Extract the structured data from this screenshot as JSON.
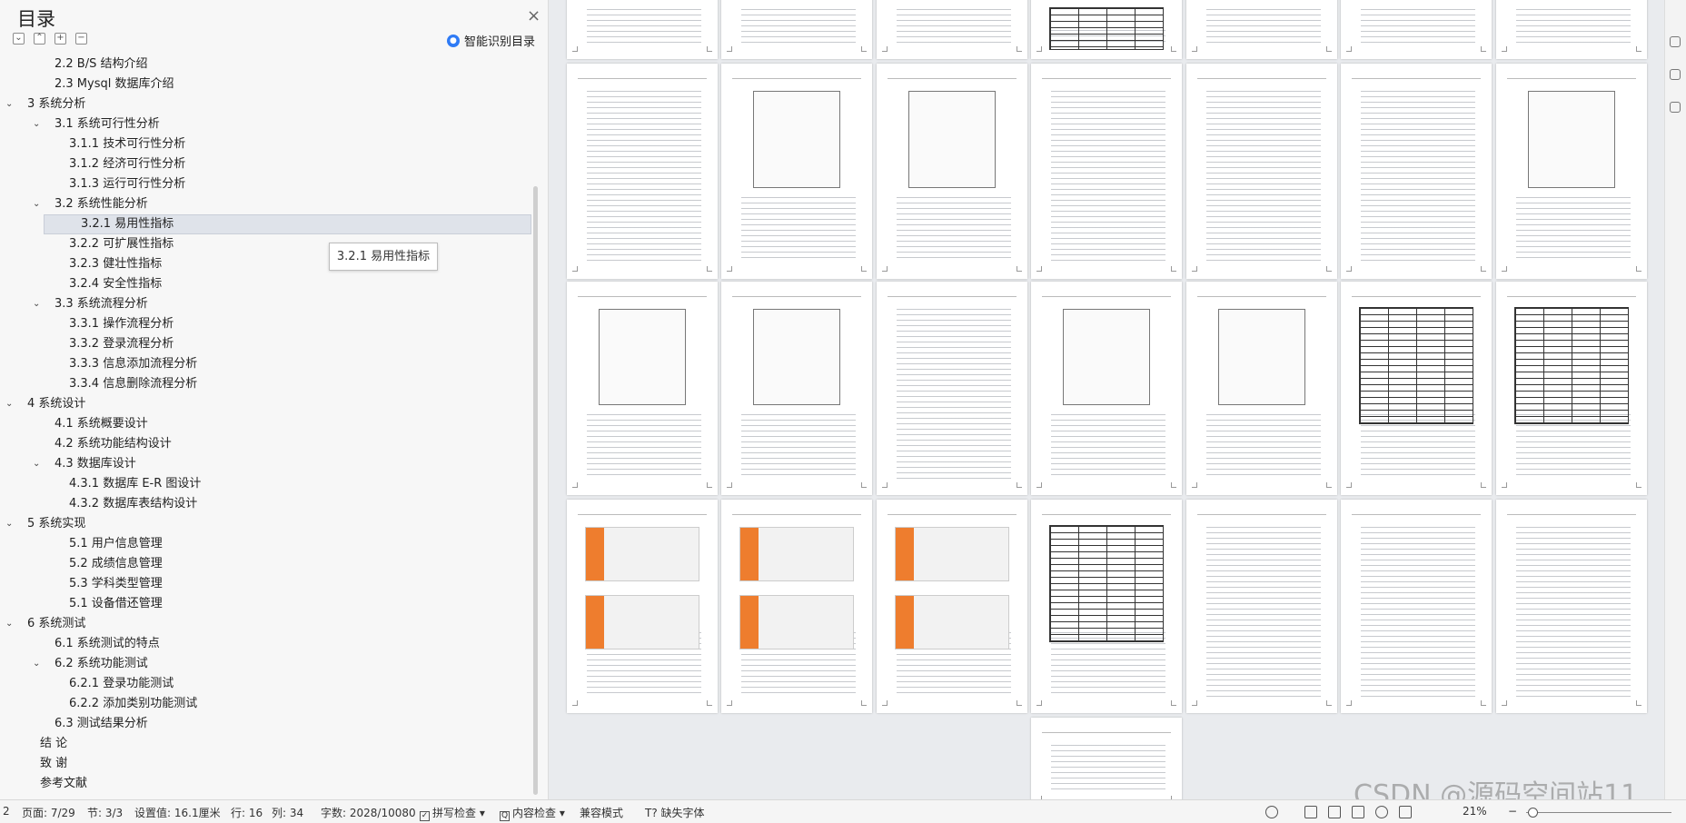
{
  "toc": {
    "title": "目录",
    "close_icon": "×",
    "smart_label": "智能识别目录",
    "items": [
      {
        "label": "2.2 B/S 结构介绍",
        "level": 2,
        "expand": ""
      },
      {
        "label": "2.3 Mysql 数据库介绍",
        "level": 2,
        "expand": ""
      },
      {
        "label": "3  系统分析",
        "level": 1,
        "expand": "⌄"
      },
      {
        "label": "3.1  系统可行性分析",
        "level": 2,
        "expand": "⌄"
      },
      {
        "label": "3.1.1  技术可行性分析",
        "level": 3,
        "expand": ""
      },
      {
        "label": "3.1.2  经济可行性分析",
        "level": 3,
        "expand": ""
      },
      {
        "label": "3.1.3  运行可行性分析",
        "level": 3,
        "expand": ""
      },
      {
        "label": "3.2  系统性能分析",
        "level": 2,
        "expand": "⌄"
      },
      {
        "label": "3.2.1  易用性指标",
        "level": 3,
        "expand": "",
        "selected": true
      },
      {
        "label": "3.2.2  可扩展性指标",
        "level": 3,
        "expand": ""
      },
      {
        "label": "3.2.3  健壮性指标",
        "level": 3,
        "expand": ""
      },
      {
        "label": "3.2.4  安全性指标",
        "level": 3,
        "expand": ""
      },
      {
        "label": "3.3  系统流程分析",
        "level": 2,
        "expand": "⌄"
      },
      {
        "label": "3.3.1  操作流程分析",
        "level": 3,
        "expand": ""
      },
      {
        "label": "3.3.2  登录流程分析",
        "level": 3,
        "expand": ""
      },
      {
        "label": "3.3.3  信息添加流程分析",
        "level": 3,
        "expand": ""
      },
      {
        "label": "3.3.4  信息删除流程分析",
        "level": 3,
        "expand": ""
      },
      {
        "label": "4  系统设计",
        "level": 1,
        "expand": "⌄"
      },
      {
        "label": "4.1  系统概要设计",
        "level": 2,
        "expand": ""
      },
      {
        "label": "4.2  系统功能结构设计",
        "level": 2,
        "expand": ""
      },
      {
        "label": "4.3  数据库设计",
        "level": 2,
        "expand": "⌄"
      },
      {
        "label": "4.3.1  数据库 E-R 图设计",
        "level": 3,
        "expand": ""
      },
      {
        "label": "4.3.2  数据库表结构设计",
        "level": 3,
        "expand": ""
      },
      {
        "label": "5  系统实现",
        "level": 1,
        "expand": "⌄"
      },
      {
        "label": "5.1 用户信息管理",
        "level": 3,
        "expand": ""
      },
      {
        "label": "5.2  成绩信息管理",
        "level": 3,
        "expand": ""
      },
      {
        "label": "5.3 学科类型管理",
        "level": 3,
        "expand": ""
      },
      {
        "label": "5.1 设备借还管理",
        "level": 3,
        "expand": ""
      },
      {
        "label": "6  系统测试",
        "level": 1,
        "expand": "⌄"
      },
      {
        "label": "6.1  系统测试的特点",
        "level": 2,
        "expand": ""
      },
      {
        "label": "6.2  系统功能测试",
        "level": 2,
        "expand": "⌄"
      },
      {
        "label": "6.2.1  登录功能测试",
        "level": 3,
        "expand": ""
      },
      {
        "label": "6.2.2  添加类别功能测试",
        "level": 3,
        "expand": ""
      },
      {
        "label": "6.3  测试结果分析",
        "level": 2,
        "expand": ""
      },
      {
        "label": "结    论",
        "level": 1.5,
        "expand": ""
      },
      {
        "label": "致    谢",
        "level": 1.5,
        "expand": ""
      },
      {
        "label": "参考文献",
        "level": 1.5,
        "expand": ""
      }
    ],
    "tooltip": "3.2.1 易用性指标"
  },
  "status": {
    "section_num": "2",
    "page": "页面: 7/29",
    "section": "节: 3/3",
    "setting": "设置值: 16.1厘米",
    "row": "行: 16",
    "col": "列: 34",
    "words": "字数: 2028/10080",
    "spell": "拼写检查",
    "content_check": "内容检查",
    "compat": "兼容模式",
    "missing_font": "缺失字体",
    "zoom": "21%"
  },
  "watermark": "CSDN @源码空间站11",
  "colors": {
    "accent_orange": "#ee7d2e",
    "select_bg": "#dfe3ea",
    "ai_blue": "#2f7bf5"
  }
}
